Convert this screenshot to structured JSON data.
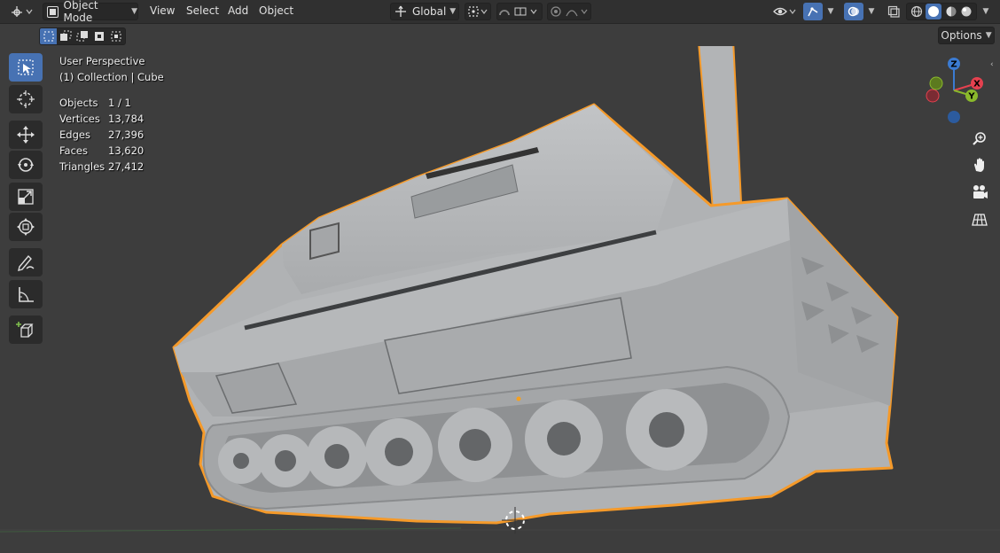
{
  "header": {
    "mode_label": "Object Mode",
    "menu": [
      "View",
      "Select",
      "Add",
      "Object"
    ],
    "orientation_label": "Global",
    "options_label": "Options"
  },
  "overlay": {
    "view_name": "User Perspective",
    "collection": "(1) Collection | Cube",
    "stats": [
      {
        "label": "Objects",
        "value": "1 / 1"
      },
      {
        "label": "Vertices",
        "value": "13,784"
      },
      {
        "label": "Edges",
        "value": "27,396"
      },
      {
        "label": "Faces",
        "value": "13,620"
      },
      {
        "label": "Triangles",
        "value": "27,412"
      }
    ]
  },
  "gizmo": {
    "x_label": "X",
    "y_label": "Y",
    "z_label": "Z"
  },
  "colors": {
    "accent": "#4772b3",
    "selection_outline": "#f59a2a",
    "axis_x": "#e5414f",
    "axis_y": "#8ab92c",
    "axis_z": "#3b7bd2",
    "model": "#b4b6b8"
  },
  "icons": {
    "tools": [
      "select-box-icon",
      "cursor-icon",
      "move-icon",
      "rotate-icon",
      "scale-icon",
      "transform-icon",
      "annotate-icon",
      "measure-icon",
      "add-cube-icon"
    ],
    "navigation": [
      "zoom-icon",
      "hand-pan-icon",
      "camera-icon",
      "grid-ortho-icon"
    ]
  }
}
